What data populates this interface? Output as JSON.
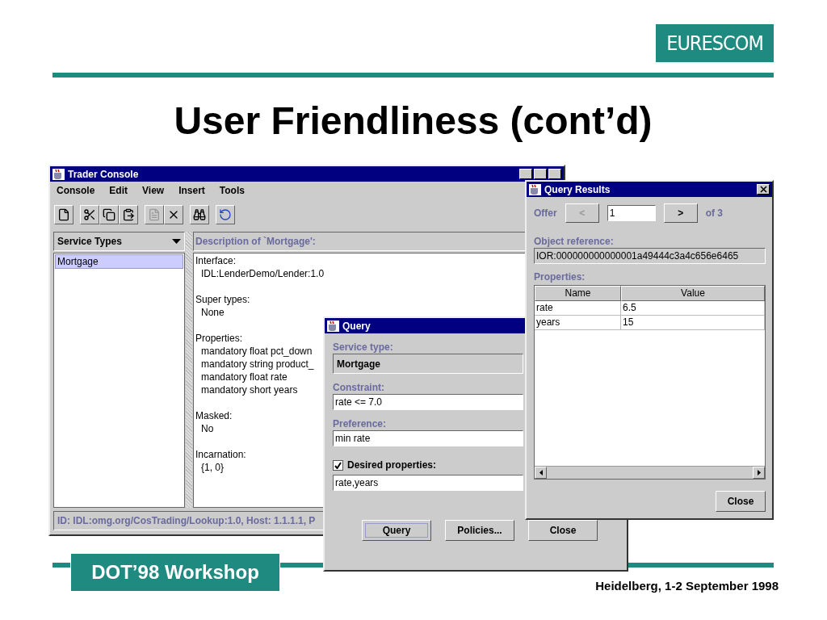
{
  "slide": {
    "logo": "EURESCOM",
    "title": "User Friendliness (cont’d)",
    "footer_badge": "DOT’98 Workshop",
    "footer_note": "Heidelberg, 1-2 September 1998"
  },
  "trader_console": {
    "title": "Trader Console",
    "menu": [
      "Console",
      "Edit",
      "View",
      "Insert",
      "Tools"
    ],
    "toolbar_groups": [
      {
        "buttons": [
          {
            "kind": "new",
            "disabled": false
          }
        ]
      },
      {
        "buttons": [
          {
            "kind": "cut",
            "disabled": false
          },
          {
            "kind": "copy",
            "disabled": false
          },
          {
            "kind": "paste",
            "disabled": false
          }
        ]
      },
      {
        "buttons": [
          {
            "kind": "document",
            "disabled": true
          },
          {
            "kind": "delete",
            "disabled": false
          }
        ]
      },
      {
        "buttons": [
          {
            "kind": "find",
            "disabled": false
          }
        ]
      },
      {
        "buttons": [
          {
            "kind": "refresh",
            "disabled": false
          }
        ]
      }
    ],
    "service_types": {
      "label": "Service Types",
      "items": [
        {
          "label": "Mortgage",
          "selected": true
        }
      ]
    },
    "description": {
      "heading": "Description of `Mortgage':",
      "sections": [
        {
          "label": "Interface:",
          "lines": [
            "IDL:LenderDemo/Lender:1.0"
          ]
        },
        {
          "label": "Super types:",
          "lines": [
            "None"
          ]
        },
        {
          "label": "Properties:",
          "lines": [
            "mandatory float pct_down",
            "mandatory string product_",
            "mandatory float rate",
            "mandatory short years"
          ]
        },
        {
          "label": "Masked:",
          "lines": [
            "No"
          ]
        },
        {
          "label": "Incarnation:",
          "lines": [
            "{1, 0}"
          ]
        }
      ]
    },
    "status": "ID: IDL:omg.org/CosTrading/Lookup:1.0, Host: 1.1.1.1, P"
  },
  "query": {
    "title": "Query",
    "service_type_label": "Service type:",
    "service_type": "Mortgage",
    "constraint_label": "Constraint:",
    "constraint": "rate <= 7.0",
    "preference_label": "Preference:",
    "preference": "min rate",
    "desired_properties": {
      "label": "Desired properties:",
      "checked": true,
      "value": "rate,years"
    },
    "buttons": [
      {
        "label": "Query",
        "focused": true
      },
      {
        "label": "Policies...",
        "focused": false
      },
      {
        "label": "Close",
        "focused": false
      }
    ]
  },
  "query_results": {
    "title": "Query Results",
    "offer_label": "Offer",
    "prev": {
      "label": "<",
      "disabled": true
    },
    "offer": "1",
    "next": {
      "label": ">",
      "disabled": false
    },
    "of_total": "of 3",
    "object_reference_label": "Object reference:",
    "object_reference": "IOR:000000000000001a49444c3a4c656e6465",
    "properties_label": "Properties:",
    "columns": [
      "Name",
      "Value"
    ],
    "rows": [
      {
        "name": "rate",
        "value": "6.5"
      },
      {
        "name": "years",
        "value": "15"
      }
    ],
    "close": "Close"
  }
}
